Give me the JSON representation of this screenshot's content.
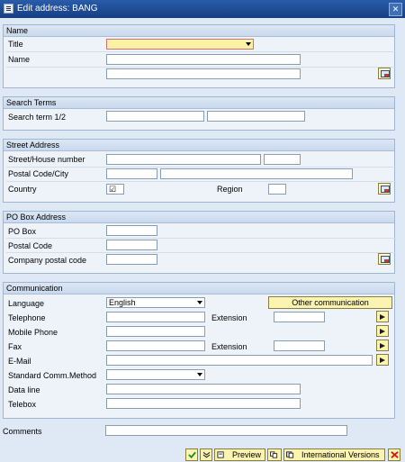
{
  "window": {
    "title": "Edit address:  BANG",
    "close_glyph": "✕"
  },
  "name_group": {
    "header": "Name",
    "title_label": "Title",
    "title_value": "",
    "name_label": "Name",
    "name1": "",
    "name2": ""
  },
  "search_group": {
    "header": "Search Terms",
    "label": "Search term 1/2",
    "term1": "",
    "term2": ""
  },
  "street_group": {
    "header": "Street Address",
    "street_label": "Street/House number",
    "street": "",
    "house_number": "",
    "postal_label": "Postal Code/City",
    "postal_code": "",
    "city": "",
    "country_label": "Country",
    "country_value": "☑",
    "region_label": "Region",
    "region_value": ""
  },
  "pobox_group": {
    "header": "PO Box Address",
    "pobox_label": "PO Box",
    "postal_code_label": "Postal Code",
    "company_postal_label": "Company postal code"
  },
  "comm_group": {
    "header": "Communication",
    "language_label": "Language",
    "language_value": "English",
    "other_comm_label": "Other communication",
    "telephone_label": "Telephone",
    "extension_label": "Extension",
    "mobile_label": "Mobile Phone",
    "fax_label": "Fax",
    "fax_extension_label": "Extension",
    "email_label": "E-Mail",
    "std_method_label": "Standard Comm.Method",
    "dataline_label": "Data line",
    "telebox_label": "Telebox"
  },
  "comments": {
    "label": "Comments",
    "value": ""
  },
  "toolbar": {
    "preview_label": "Preview",
    "intl_label": "International Versions"
  },
  "colors": {
    "title_bar": "#1e4c98",
    "required_field": "#fdf1a6",
    "button_fill": "#fbf3b0",
    "background": "#dfe9f5"
  },
  "icons": {
    "confirm": "check-icon",
    "transfer": "double-down-icon",
    "preview": "print-preview-icon",
    "intl": "globe-icon",
    "cancel": "cross-icon"
  }
}
